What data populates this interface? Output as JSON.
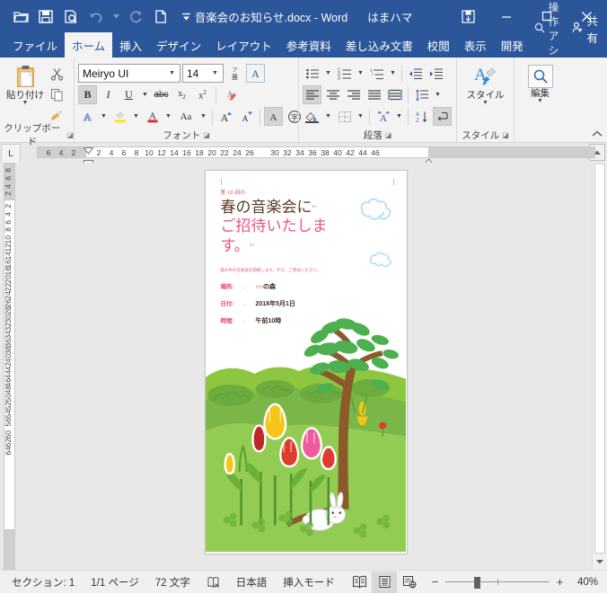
{
  "titlebar": {
    "document_title": "音楽会のお知らせ.docx",
    "separator": "-",
    "app_name": "Word",
    "user_name": "はまハマ",
    "qat": [
      {
        "name": "open-file",
        "icon": "folder-open-icon"
      },
      {
        "name": "save",
        "icon": "save-icon"
      },
      {
        "name": "print-preview",
        "icon": "print-preview-icon"
      },
      {
        "name": "undo",
        "icon": "undo-icon"
      },
      {
        "name": "redo",
        "icon": "redo-icon"
      },
      {
        "name": "new-document",
        "icon": "new-document-icon"
      },
      {
        "name": "customize-qat",
        "icon": "chevron-down-icon"
      }
    ],
    "window_buttons": {
      "ribbon_display": "ribbon-display-options-icon",
      "minimize": "minimize-icon",
      "maximize": "maximize-icon",
      "close": "close-icon"
    }
  },
  "tabs": [
    {
      "label": "ファイル",
      "active": false
    },
    {
      "label": "ホーム",
      "active": true
    },
    {
      "label": "挿入",
      "active": false
    },
    {
      "label": "デザイン",
      "active": false
    },
    {
      "label": "レイアウト",
      "active": false
    },
    {
      "label": "参考資料",
      "active": false
    },
    {
      "label": "差し込み文書",
      "active": false
    },
    {
      "label": "校閲",
      "active": false
    },
    {
      "label": "表示",
      "active": false
    },
    {
      "label": "開発",
      "active": false
    }
  ],
  "tab_right": {
    "tell_me": "操作アシ",
    "share": "共有"
  },
  "ribbon": {
    "clipboard": {
      "group_label": "クリップボード",
      "paste_label": "貼り付け",
      "cut": "切り取り",
      "copy": "コピー",
      "format_painter": "書式のコピー/貼り付け"
    },
    "font": {
      "group_label": "フォント",
      "font_name": "Meiryo UI",
      "font_size": "14",
      "bold": "B",
      "italic": "I",
      "underline": "U",
      "strikethrough": "abc",
      "subscript": "x₂",
      "superscript": "x²",
      "clear_formatting": "すべての書式をクリア",
      "text_effects": "A",
      "highlight": "ab",
      "font_color": "A",
      "change_case": "Aa",
      "grow_font": "A",
      "shrink_font": "A",
      "character_shading": "A",
      "enclose_character": "字"
    },
    "paragraph": {
      "group_label": "段落",
      "bullets": "箇条書き",
      "numbering": "段落番号",
      "multilevel": "アウトライン",
      "decrease_indent": "インデントを減らす",
      "increase_indent": "インデントを増やす",
      "align_left": "左揃え",
      "align_center": "中央揃え",
      "align_right": "右揃え",
      "justify": "両端揃え",
      "distribute": "均等割り付け",
      "line_spacing": "行間",
      "shading": "塗りつぶし",
      "borders": "罫線",
      "phonetic": "ルビ",
      "sort": "並べ替え",
      "show_marks": "編集記号の表示/非表示"
    },
    "styles": {
      "group_label": "スタイル",
      "button_label": "スタイル"
    },
    "editing": {
      "button_label": "編集"
    },
    "collapse": "リボンを折りたたむ"
  },
  "ruler": {
    "tab_selector": "L",
    "horizontal_left_margin_nums": [
      "6",
      "4",
      "2"
    ],
    "horizontal_nums": [
      "2",
      "4",
      "6",
      "8",
      "10",
      "12",
      "14",
      "16",
      "18",
      "20",
      "22",
      "24",
      "26"
    ],
    "horizontal_right_nums": [
      "30",
      "32",
      "34",
      "36",
      "38",
      "40",
      "42",
      "44",
      "46"
    ],
    "vertical_top_margin_nums": [
      "8",
      "6",
      "4",
      "2"
    ],
    "vertical_nums": [
      "2",
      "4",
      "6",
      "8",
      "10",
      "12",
      "14",
      "16",
      "18",
      "20",
      "22",
      "24",
      "26",
      "28",
      "30",
      "32",
      "34",
      "36",
      "38",
      "40",
      "42",
      "44",
      "46",
      "48",
      "50",
      "52",
      "54",
      "56"
    ],
    "vertical_bottom_margin_nums": [
      "60",
      "62",
      "64"
    ]
  },
  "document": {
    "eyebrow": "第·10·回の",
    "title_line1": "春の音楽会に",
    "title_line2": "ご招待いたしま",
    "title_line3": "す。",
    "description": "森の中の音楽会を開催します。ぜひ、ご参加ください。",
    "fields": [
      {
        "label": "場所:",
        "value": "○○の森"
      },
      {
        "label": "日付:",
        "value": "2018年5月1日"
      },
      {
        "label": "時間:",
        "value": "午前10時"
      }
    ],
    "colors": {
      "eyebrow": "#e8417f",
      "title_brown": "#5b3a21",
      "title_pink": "#f0527f",
      "field_label": "#e8417f",
      "field_value": "#3f2d20",
      "grass_light": "#8cc63f",
      "grass_mid": "#7ab648",
      "grass_dark": "#5ea83c",
      "trunk": "#8b5a2b",
      "leaf": "#4caf50",
      "cloud": "#aadcf5",
      "tulip_yellow": "#f5c518",
      "tulip_red": "#e03b2f",
      "tulip_pink": "#ef5a9c",
      "tulip_darkred": "#c0272d",
      "rabbit": "#ffffff"
    }
  },
  "statusbar": {
    "section": "セクション: 1",
    "page": "1/1 ページ",
    "words": "72 文字",
    "proofing_icon": "proofing-errors-icon",
    "language": "日本語",
    "mode": "挿入モード",
    "views": [
      {
        "name": "read-mode",
        "selected": false
      },
      {
        "name": "print-layout",
        "selected": true
      },
      {
        "name": "web-layout",
        "selected": false
      }
    ],
    "zoom_out": "−",
    "zoom_in": "+",
    "zoom_level": "40%"
  }
}
